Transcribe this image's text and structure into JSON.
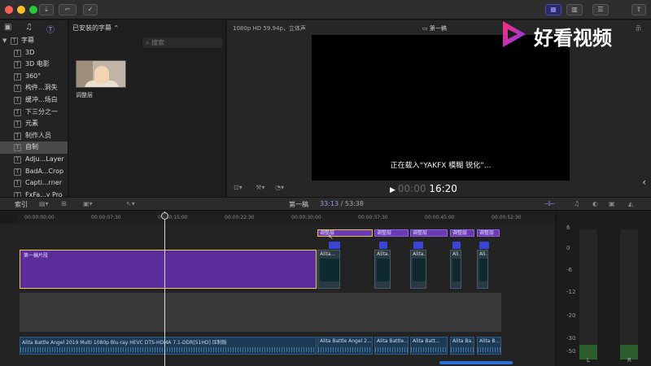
{
  "sidebar": {
    "root_label": "字幕",
    "items": [
      {
        "label": "3D"
      },
      {
        "label": "3D 电影"
      },
      {
        "label": "360°"
      },
      {
        "label": "构件...洞失"
      },
      {
        "label": "缓冲...场白"
      },
      {
        "label": "下三分之一"
      },
      {
        "label": "元素"
      },
      {
        "label": "制作人员"
      },
      {
        "label": "自制"
      },
      {
        "label": "Adju...Layer"
      },
      {
        "label": "BadA...Crop"
      },
      {
        "label": "Capti...rner"
      },
      {
        "label": "FxFa...y Pro"
      }
    ]
  },
  "browser": {
    "title": "已安装的字幕 ⌃",
    "search_placeholder": "搜索",
    "thumb_label": "调整层"
  },
  "viewer": {
    "format": "1080p HD 59.94p，立体声",
    "clip_name": "第一稿",
    "loading_text": "正在载入“YAKFX 模糊 锐化”...",
    "timecode_dim": "00:00",
    "timecode": "16:20",
    "right_label": "示"
  },
  "logo": {
    "text": "好看视频",
    "colors": {
      "left": "#ff2d6f",
      "right": "#7b3cff"
    }
  },
  "timeline_toolbar": {
    "index_label": "索引",
    "project": "第一稿",
    "timecode": "33:13",
    "duration": "/ 53:38"
  },
  "ruler": {
    "ticks": [
      "00:00:00:00",
      "00:00:07:30",
      "00:00:15:00",
      "00:00:22:30",
      "00:00:30:00",
      "00:00:37:30",
      "00:00:45:00",
      "00:00:52:30"
    ]
  },
  "tracks": {
    "title_clips": [
      "调整层",
      "调整层",
      "调整层",
      "调整层",
      "调整层"
    ],
    "compound_name": "第一稿片段",
    "video_clips": [
      "Alita...",
      "Alita...",
      "Alita...",
      "Ali...",
      "Ali..."
    ],
    "audio_clips": [
      "Alita Battle Angel 2019 Multi 1080p Blu-ray HEVC DTS-HDMA 7.1-DDR[51HD] 压制版",
      "Alita Battle Angel 2...",
      "Alita Battle...",
      "Alita Batt...",
      "Alita Ba...",
      "Alita B..."
    ]
  },
  "meters": {
    "scale": [
      "6",
      "0",
      "-6",
      "-12",
      "-20",
      "-30",
      "-50"
    ],
    "channels": [
      "L",
      "R"
    ]
  },
  "colors": {
    "accent": "#9a9aff",
    "title_clip": "#6a3ab6",
    "compound": "#5a2d9a",
    "selection": "#f2c84b",
    "audio": "#1d3a55"
  }
}
